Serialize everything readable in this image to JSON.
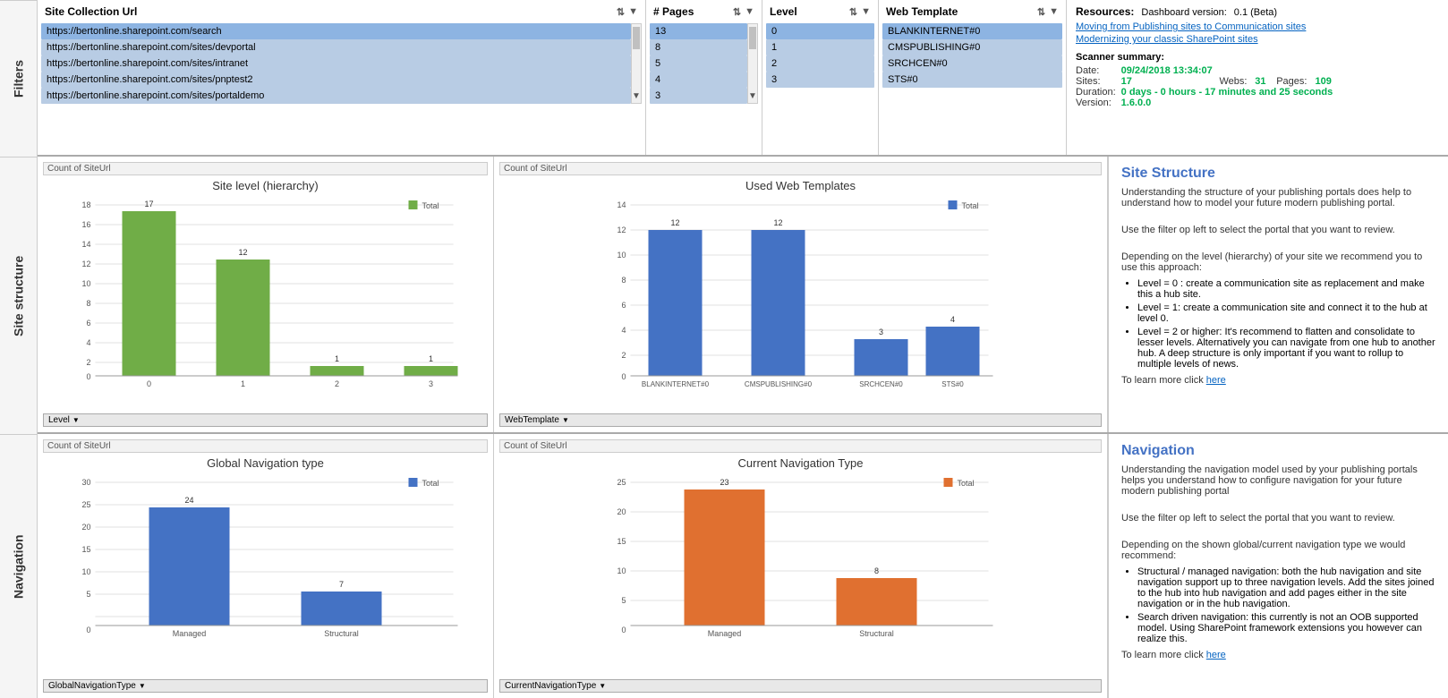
{
  "labels": {
    "filters": "Filters",
    "site_structure": "Site structure",
    "navigation": "Navigation"
  },
  "filters": {
    "site_collection_url": {
      "header": "Site Collection Url",
      "items": [
        "https://bertonline.sharepoint.com/search",
        "https://bertonline.sharepoint.com/sites/devportal",
        "https://bertonline.sharepoint.com/sites/intranet",
        "https://bertonline.sharepoint.com/sites/pnptest2",
        "https://bertonline.sharepoint.com/sites/portaldemo"
      ]
    },
    "pages": {
      "header": "# Pages",
      "items": [
        "13",
        "8",
        "5",
        "4",
        "3"
      ]
    },
    "level": {
      "header": "Level",
      "items": [
        "0",
        "1",
        "2",
        "3"
      ]
    },
    "web_template": {
      "header": "Web Template",
      "items": [
        "BLANKINTERNET#0",
        "CMSPUBLISHING#0",
        "SRCHCEN#0",
        "STS#0"
      ]
    }
  },
  "resources": {
    "title": "Resources:",
    "dashboard_label": "Dashboard version:",
    "dashboard_version": "0.1 (Beta)",
    "links": [
      "Moving from Publishing sites to Communication sites",
      "Modernizing your classic SharePoint sites"
    ],
    "scanner": {
      "title": "Scanner summary:",
      "date_label": "Date:",
      "date_value": "09/24/2018 13:34:07",
      "sites_label": "Sites:",
      "sites_value": "17",
      "webs_label": "Webs:",
      "webs_value": "31",
      "pages_label": "Pages:",
      "pages_value": "109",
      "duration_label": "Duration:",
      "duration_value": "0 days - 0 hours - 17 minutes and 25 seconds",
      "version_label": "Version:",
      "version_value": "1.6.0.0"
    }
  },
  "site_structure": {
    "chart1": {
      "count_label": "Count of SiteUrl",
      "title": "Site level (hierarchy)",
      "bars": [
        {
          "label": "0",
          "value": 17
        },
        {
          "label": "1",
          "value": 12
        },
        {
          "label": "2",
          "value": 1
        },
        {
          "label": "3",
          "value": 1
        }
      ],
      "max": 18,
      "color": "#70ad47",
      "legend": "Total",
      "dropdown_label": "Level"
    },
    "chart2": {
      "count_label": "Count of SiteUrl",
      "title": "Used Web Templates",
      "bars": [
        {
          "label": "BLANKINTERNET#0",
          "value": 12
        },
        {
          "label": "CMSPUBLISHING#0",
          "value": 12
        },
        {
          "label": "SRCHCEN#0",
          "value": 3
        },
        {
          "label": "STS#0",
          "value": 4
        }
      ],
      "max": 14,
      "color": "#4472c4",
      "legend": "Total",
      "dropdown_label": "WebTemplate"
    },
    "info": {
      "title": "Site Structure",
      "paragraphs": [
        "Understanding the structure of your publishing portals does help to understand how to model your future modern publishing portal.",
        "Use the filter op left to select the portal that you want to review.",
        "Depending on the level (hierarchy) of your site we recommend you to use this approach:"
      ],
      "bullets": [
        "Level = 0 : create a communication site as replacement and make this a hub site.",
        "Level = 1: create a communication site and connect it to the hub at level 0.",
        "Level = 2 or higher: It's recommend to flatten and consolidate to lesser levels. Alternatively you can navigate from one hub to another hub. A deep structure is only important if you want to rollup to multiple levels of news."
      ],
      "footer": "To learn more click ",
      "link_text": "here"
    }
  },
  "navigation_section": {
    "chart1": {
      "count_label": "Count of SiteUrl",
      "title": "Global Navigation type",
      "bars": [
        {
          "label": "Managed",
          "value": 24
        },
        {
          "label": "Structural",
          "value": 7
        }
      ],
      "max": 30,
      "color": "#4472c4",
      "legend": "Total",
      "dropdown_label": "GlobalNavigationType"
    },
    "chart2": {
      "count_label": "Count of SiteUrl",
      "title": "Current Navigation Type",
      "bars": [
        {
          "label": "Managed",
          "value": 23
        },
        {
          "label": "Structural",
          "value": 8
        }
      ],
      "max": 25,
      "color": "#e07030",
      "legend": "Total",
      "dropdown_label": "CurrentNavigationType"
    },
    "info": {
      "title": "Navigation",
      "paragraphs": [
        "Understanding the navigation model used by your publishing portals helps you understand how to configure navigation for your future modern publishing portal",
        "Use the filter op left to select the portal that you want to review.",
        "Depending on the shown global/current navigation type we would recommend:"
      ],
      "bullets": [
        "Structural / managed navigation: both the hub navigation and site navigation support up to three navigation levels. Add the sites joined to the hub into hub navigation and add pages either in the site navigation or in the hub navigation.",
        "Search driven navigation: this currently is not an OOB supported model. Using SharePoint framework extensions you however can realize this."
      ],
      "footer": "To learn more click ",
      "link_text": "here"
    }
  }
}
